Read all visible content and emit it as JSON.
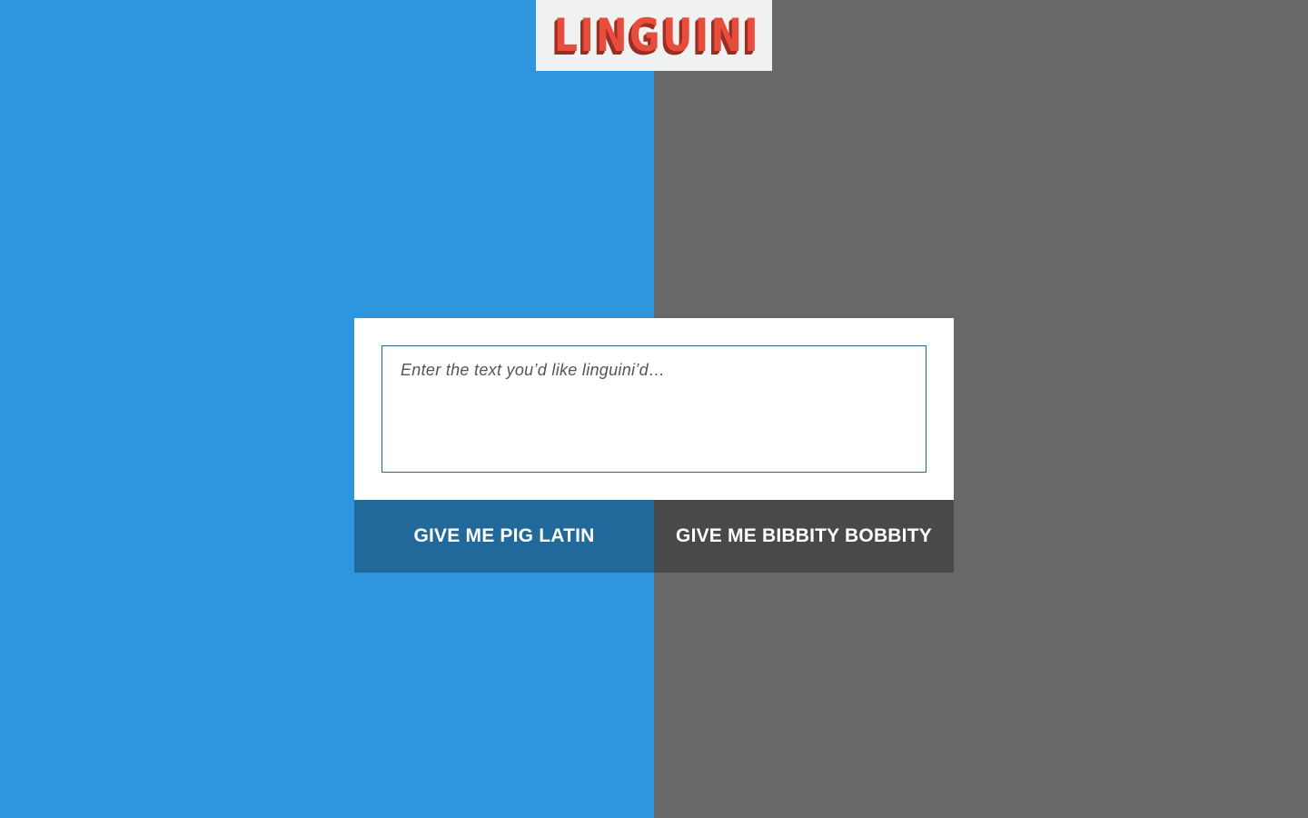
{
  "header": {
    "logo_text": "LINGUINI"
  },
  "form": {
    "input_placeholder": "Enter the text you’d like linguini’d…",
    "input_value": ""
  },
  "actions": {
    "pig_latin_label": "GIVE ME PIG LATIN",
    "bibbity_bobbity_label": "GIVE ME BIBBITY BOBBITY"
  },
  "colors": {
    "left_background": "#2e96de",
    "right_background": "#686868",
    "logo_box": "#f0f2f1",
    "logo_text": "#e84c3d",
    "logo_shadow": "#9a2e22",
    "panel_background": "#ffffff",
    "input_border": "#236698",
    "pig_latin_button": "#21699b",
    "bibbity_bobbity_button": "#494949"
  }
}
